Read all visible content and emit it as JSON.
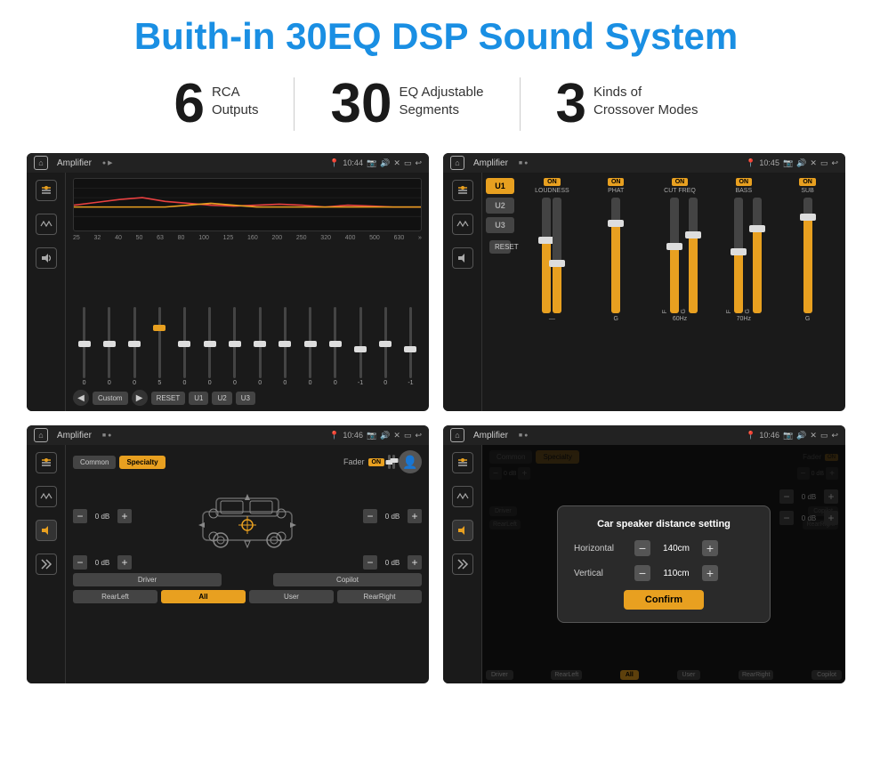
{
  "page": {
    "title": "Buith-in 30EQ DSP Sound System"
  },
  "features": [
    {
      "number": "6",
      "line1": "RCA",
      "line2": "Outputs"
    },
    {
      "number": "30",
      "line1": "EQ Adjustable",
      "line2": "Segments"
    },
    {
      "number": "3",
      "line1": "Kinds of",
      "line2": "Crossover Modes"
    }
  ],
  "screens": {
    "eq": {
      "title": "Amplifier",
      "time": "10:44",
      "freqs": [
        "25",
        "32",
        "40",
        "50",
        "63",
        "80",
        "100",
        "125",
        "160",
        "200",
        "250",
        "320",
        "400",
        "500",
        "630"
      ],
      "values": [
        "0",
        "0",
        "0",
        "5",
        "0",
        "0",
        "0",
        "0",
        "0",
        "0",
        "0",
        "-1",
        "0",
        "-1"
      ],
      "bottomBtns": [
        "Custom",
        "RESET",
        "U1",
        "U2",
        "U3"
      ]
    },
    "crossover": {
      "title": "Amplifier",
      "time": "10:45",
      "uButtons": [
        "U1",
        "U2",
        "U3"
      ],
      "controls": [
        {
          "label": "LOUDNESS",
          "on": true
        },
        {
          "label": "PHAT",
          "on": true
        },
        {
          "label": "CUT FREQ",
          "on": true
        },
        {
          "label": "BASS",
          "on": true
        },
        {
          "label": "SUB",
          "on": true
        }
      ],
      "resetLabel": "RESET"
    },
    "fader": {
      "title": "Amplifier",
      "time": "10:46",
      "tabs": [
        "Common",
        "Specialty"
      ],
      "activeTab": "Specialty",
      "faderLabel": "Fader",
      "onLabel": "ON",
      "speakerValues": {
        "topLeft": "0 dB",
        "topRight": "0 dB",
        "bottomLeft": "0 dB",
        "bottomRight": "0 dB"
      },
      "bottomBtns": [
        "Driver",
        "",
        "All",
        "",
        "User",
        "Copilot",
        "RearLeft",
        "RearRight"
      ]
    },
    "dialog": {
      "title": "Amplifier",
      "time": "10:46",
      "dialogTitle": "Car speaker distance setting",
      "horizontal": {
        "label": "Horizontal",
        "value": "140cm"
      },
      "vertical": {
        "label": "Vertical",
        "value": "110cm"
      },
      "confirmLabel": "Confirm",
      "speakerValues": {
        "topRight": "0 dB",
        "bottomRight": "0 dB"
      },
      "bottomBtns": [
        "Driver",
        "RearLeft",
        "User",
        "RearRight",
        "Copilot"
      ]
    }
  },
  "icons": {
    "home": "⌂",
    "back": "↩",
    "eq_tune": "≡",
    "wave": "〜",
    "speaker": "♪",
    "camera": "📷",
    "volume": "🔊",
    "close": "✕",
    "window": "▭",
    "arrow_left": "◀",
    "arrow_right": "▶",
    "arrow_down": "▼",
    "person": "👤",
    "minus": "−",
    "plus": "+"
  }
}
